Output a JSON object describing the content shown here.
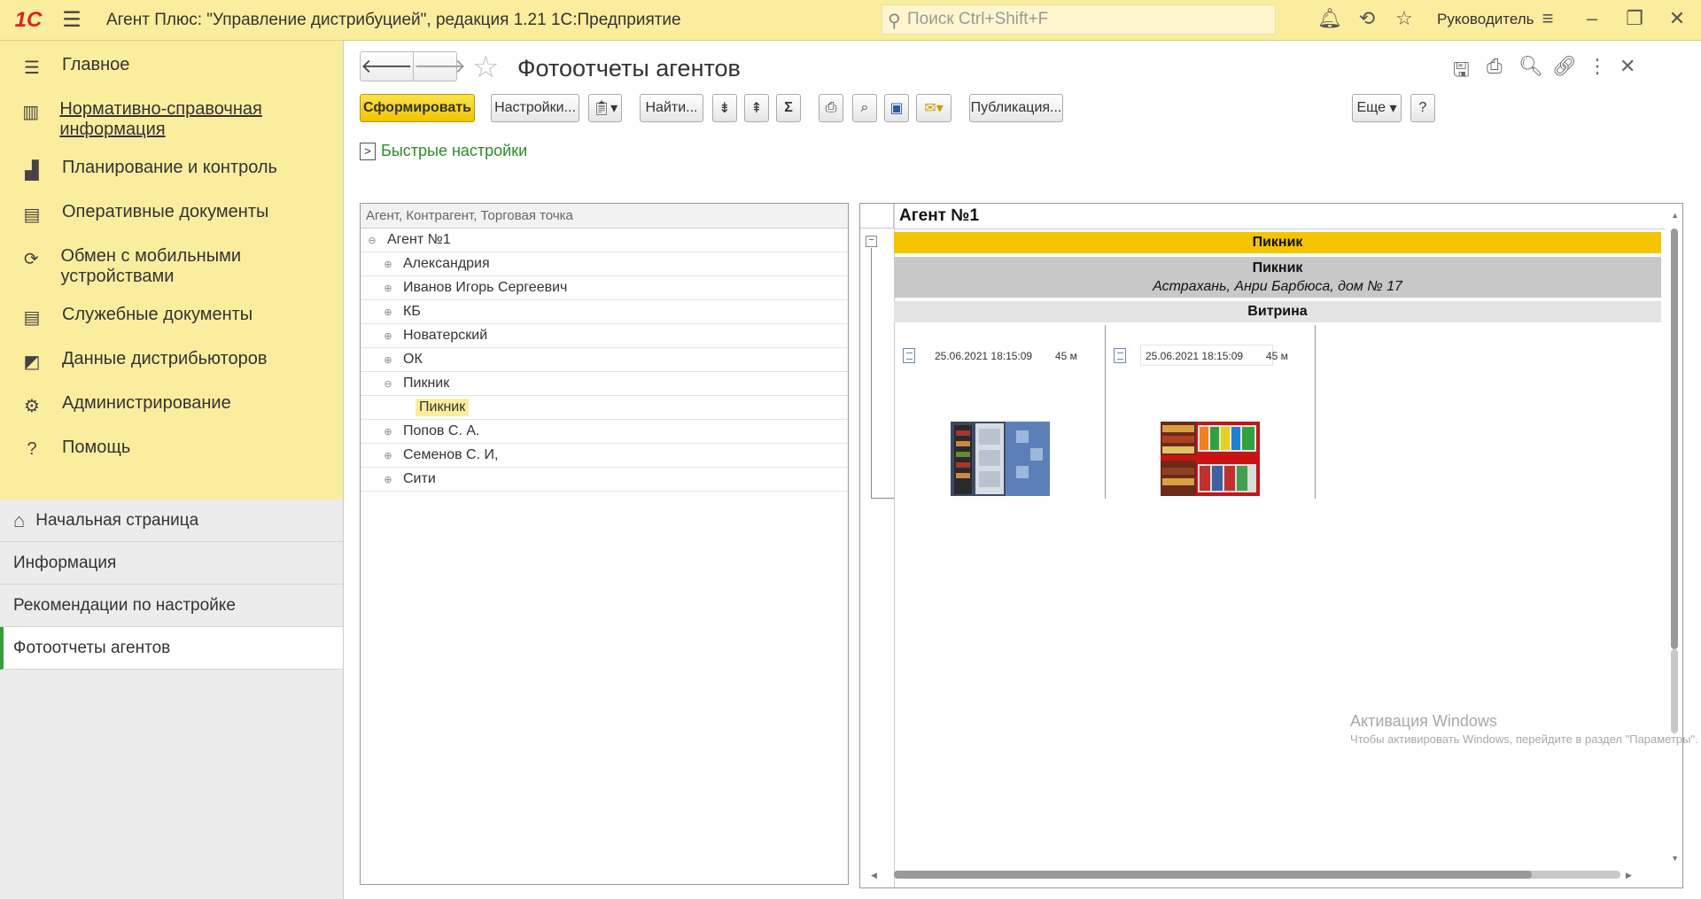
{
  "titlebar": {
    "logo": "1С",
    "title": "Агент Плюс: \"Управление дистрибуцией\", редакция 1.21 1С:Предприятие",
    "search_placeholder": "Поиск Ctrl+Shift+F",
    "user": "Руководитель"
  },
  "sidebar": {
    "sections": [
      {
        "label": "Главное",
        "icon": "menu-lines-icon"
      },
      {
        "label": "Нормативно-справочная информация",
        "icon": "grid-icon"
      },
      {
        "label": "Планирование и контроль",
        "icon": "bar-chart-icon"
      },
      {
        "label": "Оперативные документы",
        "icon": "documents-icon"
      },
      {
        "label": "Обмен с мобильными устройствами",
        "icon": "sync-icon"
      },
      {
        "label": "Служебные документы",
        "icon": "service-docs-icon"
      },
      {
        "label": "Данные дистрибьюторов",
        "icon": "distributor-icon"
      },
      {
        "label": "Администрирование",
        "icon": "gear-icon"
      },
      {
        "label": "Помощь",
        "icon": "question-icon"
      }
    ],
    "open_items": [
      {
        "label": "Начальная страница",
        "icon": "home-icon"
      },
      {
        "label": "Информация"
      },
      {
        "label": "Рекомендации по настройке"
      },
      {
        "label": "Фотоотчеты агентов",
        "active": true
      }
    ]
  },
  "page": {
    "title": "Фотоотчеты агентов",
    "toolbar": {
      "generate": "Сформировать",
      "settings": "Настройки...",
      "find": "Найти...",
      "publish": "Публикация...",
      "more": "Еще",
      "help": "?"
    },
    "quick_settings": "Быстрые настройки"
  },
  "tree": {
    "header": "Агент, Контрагент, Торговая точка",
    "root": "Агент №1",
    "children": [
      "Александрия",
      "Иванов Игорь Сергеевич",
      "КБ",
      "Новатерский",
      "ОК",
      "Пикник",
      "Попов С. А.",
      "Семенов С. И,",
      "Сити"
    ],
    "expanded_child": "Пикник",
    "selected_leaf": "Пикник"
  },
  "report": {
    "agent": "Агент №1",
    "counterparty": "Пикник",
    "outlet_name": "Пикник",
    "outlet_address": "Астрахань, Анри Барбюса, дом № 17",
    "category": "Витрина",
    "photos": [
      {
        "datetime": "25.06.2021 18:15:09",
        "duration": "45 м"
      },
      {
        "datetime": "25.06.2021 18:15:09",
        "duration": "45 м"
      }
    ]
  },
  "watermark": {
    "line1": "Активация Windows",
    "line2": "Чтобы активировать Windows, перейдите в раздел \"Параметры\"."
  },
  "colors": {
    "titlebar_bg": "#fbed9e",
    "accent_yellow": "#f5c400",
    "link_green": "#2a8c2a"
  }
}
